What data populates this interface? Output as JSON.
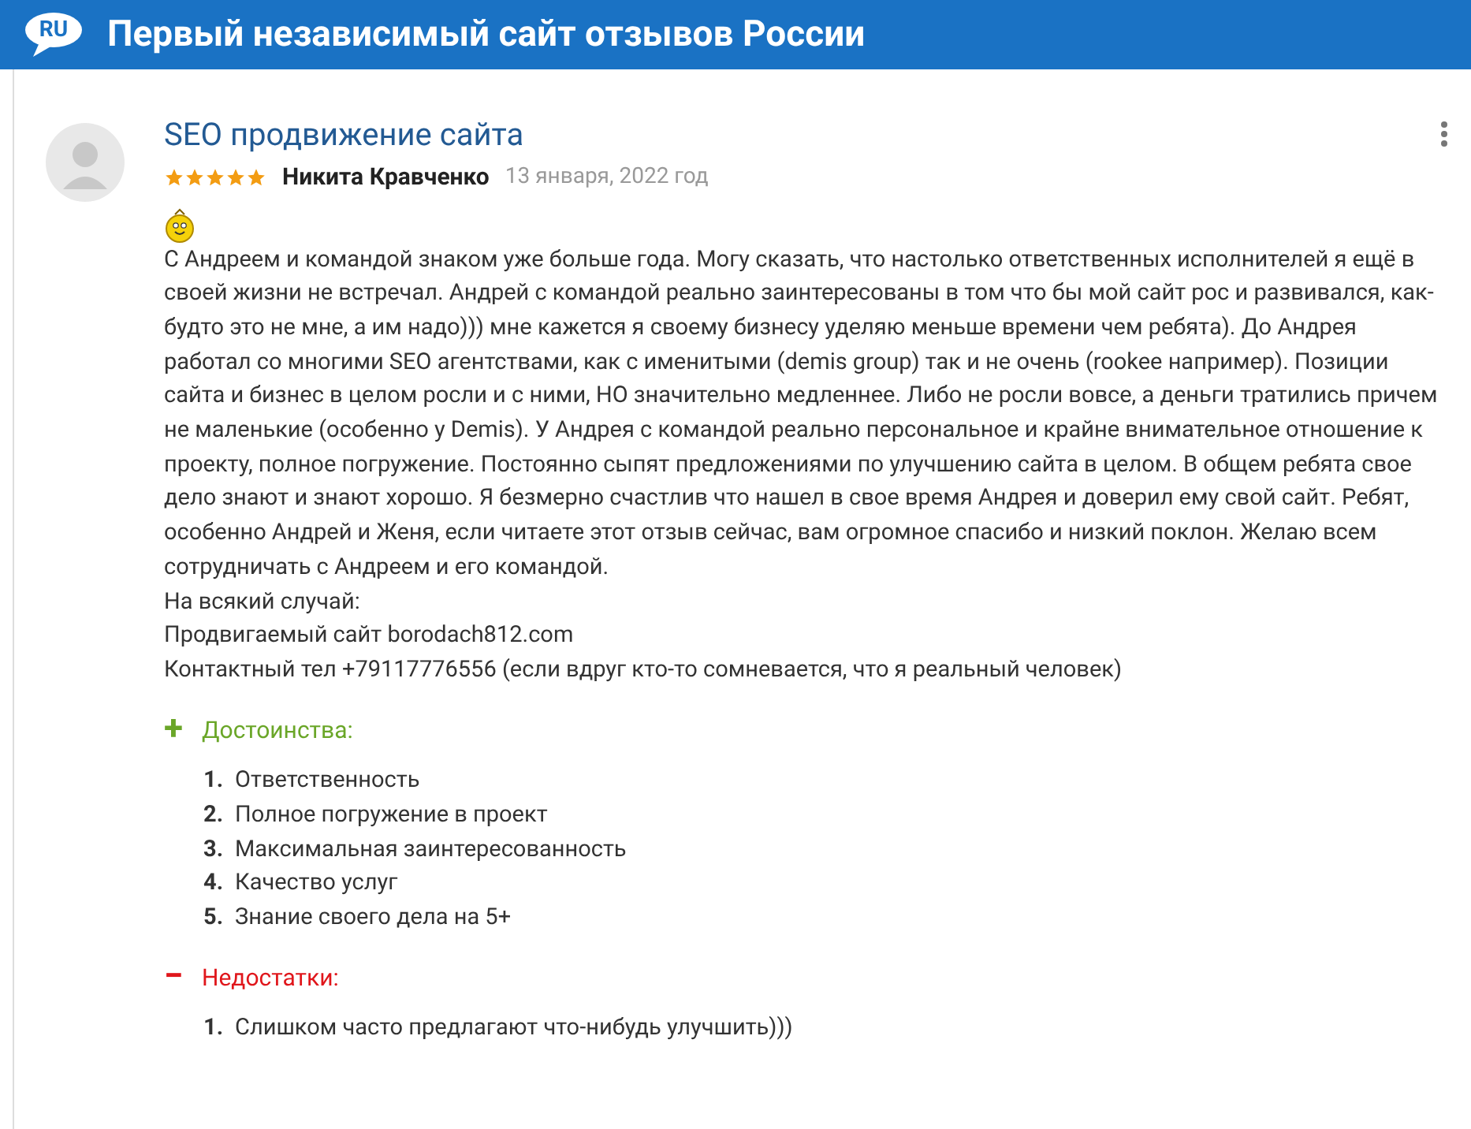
{
  "header": {
    "badge": "RU",
    "title": "Первый независимый сайт отзывов России"
  },
  "review": {
    "title": "SEO продвижение сайта",
    "stars": 5,
    "author": "Никита Кравченко",
    "date": "13 января, 2022 год",
    "body": [
      "С Андреем и командой знаком уже больше года. Могу сказать, что настолько ответственных исполнителей я ещё в своей жизни не встречал. Андрей с командой реально заинтересованы в том что бы мой сайт рос и развивался, как-будто это не мне, а им надо))) мне кажется я своему бизнесу уделяю меньше времени чем ребята). До Андрея работал со многими SEO агентствами, как с именитыми (demis group) так и не очень (rookee например). Позиции сайта и бизнес в целом росли и с ними, НО значительно медленнее. Либо не росли вовсе, а деньги тратились причем не маленькие (особенно у Demis). У Андрея с командой реально персональное и крайне внимательное отношение к проекту, полное погружение. Постоянно сыпят предложениями по улучшению сайта в целом. В общем ребята свое дело знают и знают хорошо. Я безмерно счастлив что нашел в свое время Андрея и доверил ему свой сайт. Ребят, особенно Андрей и Женя, если читаете этот отзыв сейчас, вам огромное спасибо и низкий поклон. Желаю всем сотрудничать с Андреем и его командой.",
      "На всякий случай:",
      "Продвигаемый сайт borodach812.com",
      "Контактный тел +79117776556 (если вдруг кто-то сомневается, что я реальный человек)"
    ],
    "sections": [
      {
        "kind": "pros",
        "sign": "+",
        "heading": "Достоинства:",
        "items": [
          {
            "num": "1.",
            "text": "Ответственность"
          },
          {
            "num": "2.",
            "text": "Полное погружение в проект"
          },
          {
            "num": "3.",
            "text": "Максимальная заинтересованность"
          },
          {
            "num": "4.",
            "text": "Качество услуг"
          },
          {
            "num": "5.",
            "text": "Знание своего дела на 5+"
          }
        ]
      },
      {
        "kind": "cons",
        "sign": "−",
        "heading": "Недостатки:",
        "items": [
          {
            "num": "1.",
            "text": "Слишком часто предлагают что-нибудь улучшить)))"
          }
        ]
      }
    ]
  }
}
